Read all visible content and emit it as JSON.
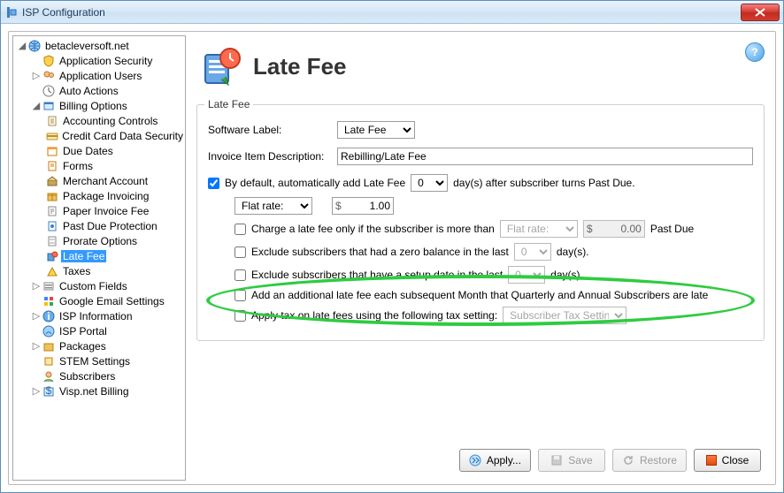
{
  "window": {
    "title": "ISP Configuration"
  },
  "tree": {
    "root": "betacleversoft.net",
    "items": [
      {
        "label": "Application Security"
      },
      {
        "label": "Application Users"
      },
      {
        "label": "Auto Actions"
      },
      {
        "label": "Billing Options",
        "expanded": true,
        "children": [
          {
            "label": "Accounting Controls"
          },
          {
            "label": "Credit Card Data Security"
          },
          {
            "label": "Due Dates"
          },
          {
            "label": "Forms"
          },
          {
            "label": "Merchant Account"
          },
          {
            "label": "Package Invoicing"
          },
          {
            "label": "Paper Invoice Fee"
          },
          {
            "label": "Past Due Protection"
          },
          {
            "label": "Prorate Options"
          },
          {
            "label": "Late Fee",
            "selected": true
          },
          {
            "label": "Taxes"
          }
        ]
      },
      {
        "label": "Custom Fields"
      },
      {
        "label": "Google Email Settings"
      },
      {
        "label": "ISP Information"
      },
      {
        "label": "ISP Portal"
      },
      {
        "label": "Packages"
      },
      {
        "label": "STEM Settings"
      },
      {
        "label": "Subscribers"
      },
      {
        "label": "Visp.net Billing"
      }
    ]
  },
  "page": {
    "title": "Late Fee",
    "group_legend": "Late Fee",
    "software_label_lbl": "Software Label:",
    "software_label_value": "Late Fee",
    "invoice_desc_lbl": "Invoice Item Description:",
    "invoice_desc_value": "Rebilling/Late Fee",
    "auto_add": {
      "checked": true,
      "pre": "By default, automatically add Late Fee",
      "days": "0",
      "post": "day(s) after subscriber turns Past Due."
    },
    "rate_type": "Flat rate:",
    "rate_amount": "1.00",
    "chk_threshold": {
      "checked": false,
      "label": "Charge a late fee only if the subscriber is more than",
      "type": "Flat rate:",
      "amount": "0.00",
      "suffix": "Past Due"
    },
    "chk_zero_balance": {
      "checked": false,
      "label": "Exclude subscribers that had a zero balance in the last",
      "days": "0",
      "suffix": "day(s)."
    },
    "chk_setup_date": {
      "checked": false,
      "label": "Exclude subscribers that have a setup date in the last",
      "days": "0",
      "suffix": "day(s)."
    },
    "chk_additional": {
      "checked": false,
      "label": "Add an additional late fee each subsequent Month that Quarterly and Annual Subscribers are late"
    },
    "chk_tax": {
      "checked": false,
      "label": "Apply tax on late fees using the following tax setting:",
      "value": "Subscriber Tax Setting"
    }
  },
  "buttons": {
    "apply": "Apply...",
    "save": "Save",
    "restore": "Restore",
    "close": "Close"
  }
}
